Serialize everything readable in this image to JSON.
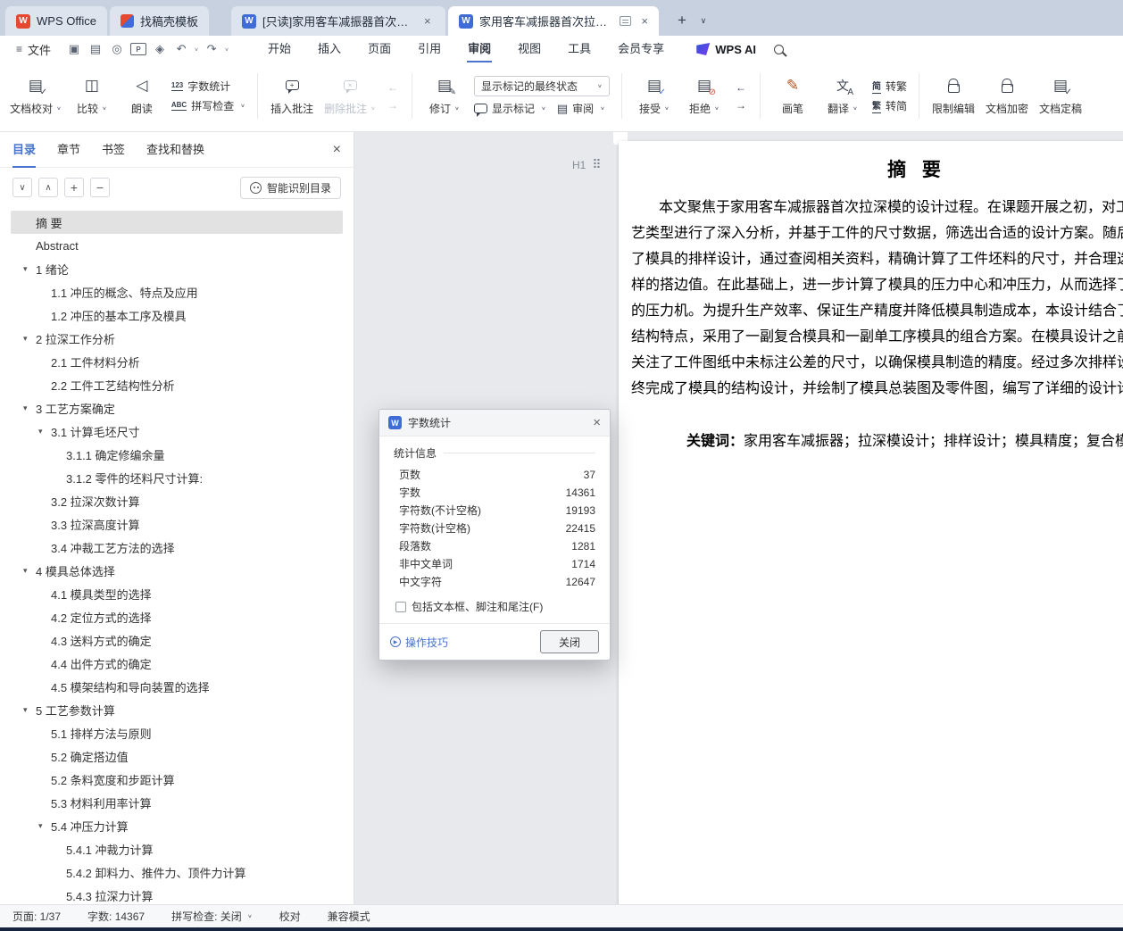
{
  "window_tabs": {
    "home_label": "WPS Office",
    "template_label": "找稿壳模板",
    "readonly_doc_label": "[只读]家用客车减振器首次拉深模设计",
    "active_doc_label": "家用客车减振器首次拉深模设"
  },
  "menubar": {
    "file_label": "文件",
    "tabs": [
      "开始",
      "插入",
      "页面",
      "引用",
      "审阅",
      "视图",
      "工具",
      "会员专享"
    ],
    "active_tab": "审阅",
    "wps_ai_label": "WPS AI"
  },
  "ribbon": {
    "doc_proof": "文档校对",
    "compare": "比较",
    "read_aloud": "朗读",
    "count_icon_text": "123",
    "word_count": "字数统计",
    "spell_icon_text": "ABC",
    "spell_check": "拼写检查",
    "insert_comment": "插入批注",
    "delete_comment": "删除批注",
    "revise": "修订",
    "markup_state_select": "显示标记的最终状态",
    "show_markup": "显示标记",
    "review": "审阅",
    "accept": "接受",
    "reject": "拒绝",
    "brush": "画笔",
    "translate": "翻译",
    "jian_icon": "简",
    "to_traditional": "转繁",
    "fan_icon": "繁",
    "to_simplified": "转简",
    "restrict_edit": "限制编辑",
    "doc_encrypt": "文档加密",
    "doc_finalize": "文档定稿"
  },
  "sidebar": {
    "tabs": [
      "目录",
      "章节",
      "书签",
      "查找和替换"
    ],
    "active_tab": "目录",
    "smart_toc_button": "智能识别目录",
    "outline": [
      {
        "label": "摘 要",
        "level": 0,
        "has_children": false,
        "selected": true
      },
      {
        "label": "Abstract",
        "level": 0,
        "has_children": false
      },
      {
        "label": "1 绪论",
        "level": 0,
        "has_children": true
      },
      {
        "label": "1.1  冲压的概念、特点及应用",
        "level": 1
      },
      {
        "label": "1.2  冲压的基本工序及模具",
        "level": 1
      },
      {
        "label": "2 拉深工作分析",
        "level": 0,
        "has_children": true
      },
      {
        "label": "2.1 工件材料分析",
        "level": 1
      },
      {
        "label": "2.2 工件工艺结构性分析",
        "level": 1
      },
      {
        "label": "3 工艺方案确定",
        "level": 0,
        "has_children": true
      },
      {
        "label": "3.1 计算毛坯尺寸",
        "level": 1,
        "has_children": true
      },
      {
        "label": "3.1.1 确定修编余量",
        "level": 2
      },
      {
        "label": "3.1.2 零件的坯料尺寸计算:",
        "level": 2
      },
      {
        "label": "3.2 拉深次数计算",
        "level": 1
      },
      {
        "label": "3.3 拉深高度计算",
        "level": 1
      },
      {
        "label": "3.4 冲裁工艺方法的选择",
        "level": 1
      },
      {
        "label": "4 模具总体选择",
        "level": 0,
        "has_children": true
      },
      {
        "label": "4.1 模具类型的选择",
        "level": 1
      },
      {
        "label": "4.2 定位方式的选择",
        "level": 1
      },
      {
        "label": "4.3 送料方式的确定",
        "level": 1
      },
      {
        "label": "4.4 出件方式的确定",
        "level": 1
      },
      {
        "label": "4.5 模架结构和导向装置的选择",
        "level": 1
      },
      {
        "label": "5 工艺参数计算",
        "level": 0,
        "has_children": true
      },
      {
        "label": "5.1 排样方法与原则",
        "level": 1
      },
      {
        "label": "5.2 确定搭边值",
        "level": 1
      },
      {
        "label": "5.2 条料宽度和步距计算",
        "level": 1
      },
      {
        "label": "5.3 材料利用率计算",
        "level": 1
      },
      {
        "label": "5.4 冲压力计算",
        "level": 1,
        "has_children": true
      },
      {
        "label": "5.4.1 冲裁力计算",
        "level": 2
      },
      {
        "label": "5.4.2 卸料力、推件力、顶件力计算",
        "level": 2
      },
      {
        "label": "5.4.3 拉深力计算",
        "level": 2
      }
    ]
  },
  "document": {
    "heading_marker": "H1",
    "title": "摘  要",
    "body_lines": [
      "本文聚焦于家用客车减振器首次拉深模的设计过程。在课题开展之初，对工",
      "艺类型进行了深入分析，并基于工件的尺寸数据，筛选出合适的设计方案。随后",
      "了模具的排样设计，通过查阅相关资料，精确计算了工件坯料的尺寸，并合理选",
      "样的搭边值。在此基础上，进一步计算了模具的压力中心和冲压力，从而选择了",
      "的压力机。为提升生产效率、保证生产精度并降低模具制造成本，本设计结合了",
      "结构特点，采用了一副复合模具和一副单工序模具的组合方案。在模具设计之前",
      "关注了工件图纸中未标注公差的尺寸，以确保模具制造的精度。经过多次排样设",
      "终完成了模具的结构设计，并绘制了模具总装图及零件图，编写了详细的设计计"
    ],
    "keywords_label": "关键词：",
    "keywords_text": "家用客车减振器；拉深模设计；排样设计；模具精度；复合模具"
  },
  "word_count_dialog": {
    "title": "字数统计",
    "group_label": "统计信息",
    "rows": [
      {
        "label": "页数",
        "value": "37"
      },
      {
        "label": "字数",
        "value": "14361"
      },
      {
        "label": "字符数(不计空格)",
        "value": "19193"
      },
      {
        "label": "字符数(计空格)",
        "value": "22415"
      },
      {
        "label": "段落数",
        "value": "1281"
      },
      {
        "label": "非中文单词",
        "value": "1714"
      },
      {
        "label": "中文字符",
        "value": "12647"
      }
    ],
    "checkbox_label": "包括文本框、脚注和尾注(F)",
    "checkbox_checked": false,
    "tips_link": "操作技巧",
    "close_button": "关闭"
  },
  "statusbar": {
    "page": "页面: 1/37",
    "words": "字数: 14367",
    "spellcheck": "拼写检查: 关闭",
    "proof": "校对",
    "compat_mode": "兼容模式"
  },
  "colors": {
    "accent": "#4874cb",
    "tabbar_bg": "#c7d1e0",
    "doc_area_bg": "#e7e9ed",
    "writer_blue": "#3f6cd6",
    "wps_red": "#e5492f",
    "selected_row_bg": "#e2e2e2"
  },
  "icons": {
    "note": "semantic icon names carried as data-name on elements",
    "list": [
      "wps-logo-icon",
      "writer-doc-icon",
      "template-app-icon",
      "close-icon",
      "new-tab-plus-icon",
      "chevron-down-icon",
      "hamburger-icon",
      "save-icon",
      "print-icon",
      "print-preview-icon",
      "export-pdf-icon",
      "share-icon",
      "undo-icon",
      "redo-icon",
      "wps-ai-logo-icon",
      "search-icon",
      "doc-proof-icon",
      "compare-icon",
      "read-aloud-icon",
      "word-count-icon",
      "spell-check-icon",
      "comment-bubble-icon",
      "track-changes-icon",
      "accept-icon",
      "reject-icon",
      "brush-icon",
      "translate-icon",
      "lock-icon",
      "collapse-arrow-icon",
      "drag-handle-icon",
      "play-circle-icon",
      "checkbox-icon"
    ]
  }
}
